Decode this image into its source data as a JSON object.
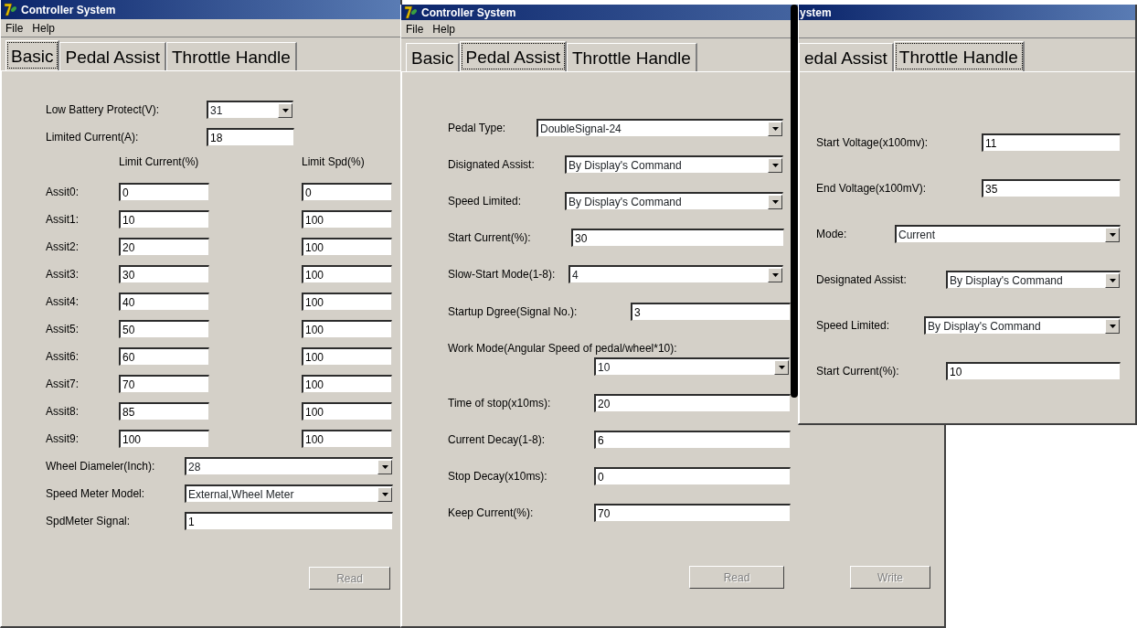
{
  "windows": [
    {
      "title": "Controller System",
      "menu": [
        "File",
        "Help"
      ],
      "tabs": [
        {
          "label": "Basic",
          "selected": true
        },
        {
          "label": "Pedal Assist",
          "selected": false
        },
        {
          "label": "Throttle Handle",
          "selected": false
        }
      ],
      "rows": [
        {
          "kind": "dropdown",
          "label": "Low Battery Protect(V):",
          "value": "31"
        },
        {
          "kind": "text",
          "label": "Limited Current(A):",
          "value": "18"
        },
        {
          "kind": "headings",
          "columns": [
            "Limit Current(%)",
            "Limit Spd(%)"
          ]
        },
        {
          "kind": "pair",
          "label": "Assit0:",
          "values": [
            "0",
            "0"
          ]
        },
        {
          "kind": "pair",
          "label": "Assit1:",
          "values": [
            "10",
            "100"
          ]
        },
        {
          "kind": "pair",
          "label": "Assit2:",
          "values": [
            "20",
            "100"
          ]
        },
        {
          "kind": "pair",
          "label": "Assit3:",
          "values": [
            "30",
            "100"
          ]
        },
        {
          "kind": "pair",
          "label": "Assit4:",
          "values": [
            "40",
            "100"
          ]
        },
        {
          "kind": "pair",
          "label": "Assit5:",
          "values": [
            "50",
            "100"
          ]
        },
        {
          "kind": "pair",
          "label": "Assit6:",
          "values": [
            "60",
            "100"
          ]
        },
        {
          "kind": "pair",
          "label": "Assit7:",
          "values": [
            "70",
            "100"
          ]
        },
        {
          "kind": "pair",
          "label": "Assit8:",
          "values": [
            "85",
            "100"
          ]
        },
        {
          "kind": "pair",
          "label": "Assit9:",
          "values": [
            "100",
            "100"
          ]
        },
        {
          "kind": "dropdown",
          "label": "Wheel Diameler(Inch):",
          "value": "28"
        },
        {
          "kind": "dropdown",
          "label": "Speed Meter Model:",
          "value": "External,Wheel Meter"
        },
        {
          "kind": "text",
          "label": "SpdMeter Signal:",
          "value": "1"
        }
      ],
      "buttons": [
        {
          "label": "Read",
          "disabled": true
        }
      ]
    },
    {
      "title": "Controller System",
      "menu": [
        "File",
        "Help"
      ],
      "tabs": [
        {
          "label": "Basic",
          "selected": false
        },
        {
          "label": "Pedal Assist",
          "selected": true
        },
        {
          "label": "Throttle Handle",
          "selected": false
        }
      ],
      "rows": [
        {
          "kind": "dropdown",
          "label": "Pedal Type:",
          "value": "DoubleSignal-24"
        },
        {
          "kind": "dropdown",
          "label": "Disignated Assist:",
          "value": "By Display's Command"
        },
        {
          "kind": "dropdown",
          "label": "Speed Limited:",
          "value": "By Display's Command"
        },
        {
          "kind": "text",
          "label": "Start Current(%):",
          "value": "30"
        },
        {
          "kind": "dropdown",
          "label": "Slow-Start Mode(1-8):",
          "value": "4"
        },
        {
          "kind": "text",
          "label": "Startup Dgree(Signal No.):",
          "value": "3"
        },
        {
          "kind": "dropdown_below",
          "label": "Work Mode(Angular Speed of pedal/wheel*10):",
          "value": "10"
        },
        {
          "kind": "text",
          "label": "Time of stop(x10ms):",
          "value": "20"
        },
        {
          "kind": "text",
          "label": "Current Decay(1-8):",
          "value": "6"
        },
        {
          "kind": "text",
          "label": "Stop Decay(x10ms):",
          "value": "0"
        },
        {
          "kind": "text",
          "label": "Keep Current(%):",
          "value": "70"
        }
      ],
      "buttons": [
        {
          "label": "Read",
          "disabled": true
        },
        {
          "label": "Write",
          "disabled": true
        }
      ]
    },
    {
      "title": "ystem",
      "tabs": [
        {
          "label": "edal Assist",
          "selected": false
        },
        {
          "label": "Throttle Handle",
          "selected": true
        }
      ],
      "rows": [
        {
          "kind": "text",
          "label": "Start Voltage(x100mv):",
          "value": "11"
        },
        {
          "kind": "text",
          "label": "End Voltage(x100mV):",
          "value": "35"
        },
        {
          "kind": "dropdown",
          "label": "Mode:",
          "value": "Current"
        },
        {
          "kind": "dropdown",
          "label": "Designated Assist:",
          "value": "By Display's Command"
        },
        {
          "kind": "dropdown",
          "label": "Speed Limited:",
          "value": "By Display's Command"
        },
        {
          "kind": "text",
          "label": "Start Current(%):",
          "value": "10"
        }
      ]
    }
  ]
}
